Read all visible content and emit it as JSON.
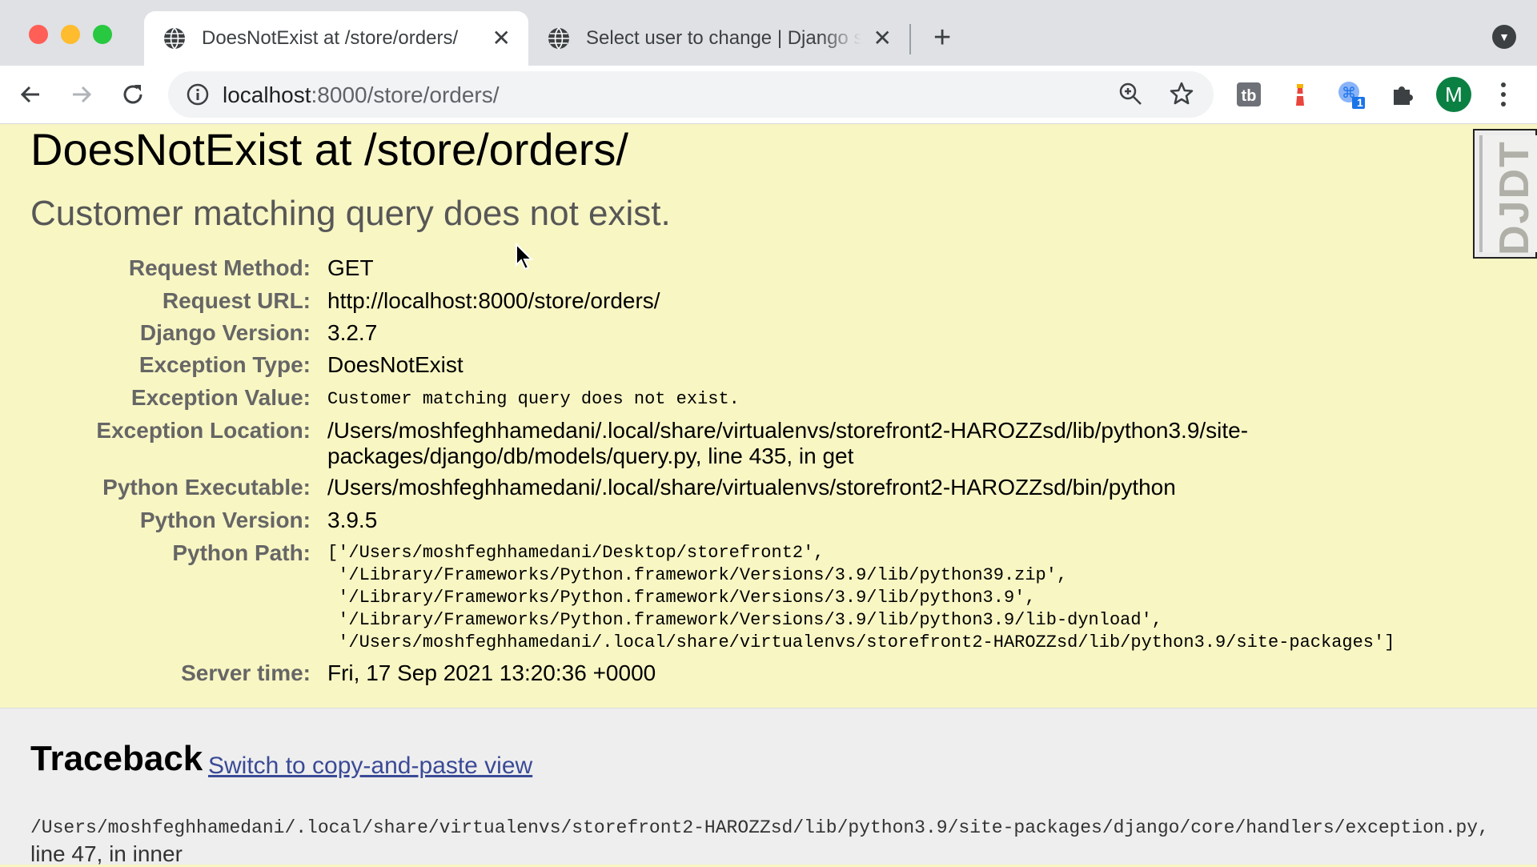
{
  "browser": {
    "tabs": [
      {
        "title": "DoesNotExist at /store/orders/",
        "active": true
      },
      {
        "title": "Select user to change | Django site admin",
        "active": false
      }
    ],
    "url_host": "localhost",
    "url_rest": ":8000/store/orders/",
    "extension_badge": "1",
    "profile_initial": "M",
    "colors": {
      "close": "#ff5f57",
      "minimize": "#febc2e",
      "maximize": "#28c840",
      "avatar": "#0b8043"
    }
  },
  "error": {
    "title": "DoesNotExist at /store/orders/",
    "message": "Customer matching query does not exist.",
    "meta": [
      {
        "label": "Request Method:",
        "value": "GET"
      },
      {
        "label": "Request URL:",
        "value": "http://localhost:8000/store/orders/"
      },
      {
        "label": "Django Version:",
        "value": "3.2.7"
      },
      {
        "label": "Exception Type:",
        "value": "DoesNotExist"
      },
      {
        "label": "Exception Value:",
        "value": "Customer matching query does not exist."
      },
      {
        "label": "Exception Location:",
        "value_line1": "/Users/moshfeghhamedani/.local/share/virtualenvs/storefront2-HAROZZsd/lib/python3.9/site-",
        "value_line2": "packages/django/db/models/query.py, line 435, in get"
      },
      {
        "label": "Python Executable:",
        "value": "/Users/moshfeghhamedani/.local/share/virtualenvs/storefront2-HAROZZsd/bin/python"
      },
      {
        "label": "Python Version:",
        "value": "3.9.5"
      },
      {
        "label": "Python Path:",
        "lines": [
          "['/Users/moshfeghhamedani/Desktop/storefront2',",
          " '/Library/Frameworks/Python.framework/Versions/3.9/lib/python39.zip',",
          " '/Library/Frameworks/Python.framework/Versions/3.9/lib/python3.9',",
          " '/Library/Frameworks/Python.framework/Versions/3.9/lib/python3.9/lib-dynload',",
          " '/Users/moshfeghhamedani/.local/share/virtualenvs/storefront2-HAROZZsd/lib/python3.9/site-packages']"
        ]
      },
      {
        "label": "Server time:",
        "value": "Fri, 17 Sep 2021 13:20:36 +0000"
      }
    ],
    "colors": {
      "summary_bg": "#f8f6c3",
      "traceback_bg": "#eeeeee"
    }
  },
  "debug_toolbar": {
    "label": "DJDT"
  },
  "traceback": {
    "title": "Traceback",
    "switch_link": "Switch to copy-and-paste view",
    "frame_file": "/Users/moshfeghhamedani/.local/share/virtualenvs/storefront2-HAROZZsd/lib/python3.9/site-packages/django/core/handlers/exception.py,",
    "frame_line": "line 47, in inner"
  }
}
